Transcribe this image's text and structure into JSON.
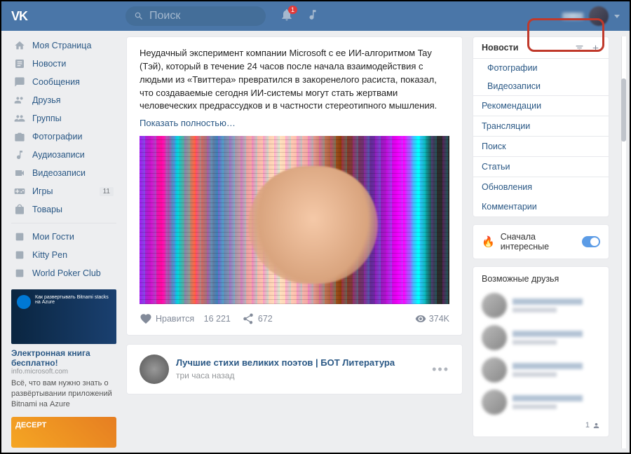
{
  "search_placeholder": "Поиск",
  "notif_count": "1",
  "sidebar": {
    "items": [
      {
        "label": "Моя Страница"
      },
      {
        "label": "Новости"
      },
      {
        "label": "Сообщения"
      },
      {
        "label": "Друзья"
      },
      {
        "label": "Группы"
      },
      {
        "label": "Фотографии"
      },
      {
        "label": "Аудиозаписи"
      },
      {
        "label": "Видеозаписи"
      },
      {
        "label": "Игры",
        "badge": "11"
      },
      {
        "label": "Товары"
      }
    ],
    "apps": [
      {
        "label": "Мои Гости"
      },
      {
        "label": "Kitty Pen"
      },
      {
        "label": "World Poker Club"
      }
    ]
  },
  "ad": {
    "title": "Электронная книга бесплатно!",
    "subtitle": "info.microsoft.com",
    "text": "Всё, что вам нужно знать о развёртывании приложений Bitnami на Azure",
    "inner": "Как развертывать Bitnami stacks на Azure"
  },
  "ad2": "ДЕСЕРТ",
  "post1": {
    "text": "Неудачный эксперимент компании Microsoft с ее ИИ-алгоритмом Tay (Тэй), который в течение 24 часов после начала взаимодействия с людьми из «Твиттера» превратился в закоренелого расиста, показал, что создаваемые сегодня ИИ-системы могут стать жертвами человеческих предрассудков и в частности стереотипного мышления.",
    "more": "Показать полностью…",
    "like_label": "Нравится",
    "likes": "16 221",
    "shares": "672",
    "views": "374K"
  },
  "post2": {
    "name": "Лучшие стихи великих поэтов | БОТ Литература",
    "time": "три часа назад"
  },
  "tabs": {
    "header": "Новости",
    "sub": [
      "Фотографии",
      "Видеозаписи"
    ],
    "main": [
      "Рекомендации",
      "Трансляции",
      "Поиск",
      "Статьи"
    ],
    "extra": [
      "Обновления",
      "Комментарии"
    ]
  },
  "feature": "Сначала интересные",
  "friends_h": "Возможные друзья",
  "friends_count": "1"
}
